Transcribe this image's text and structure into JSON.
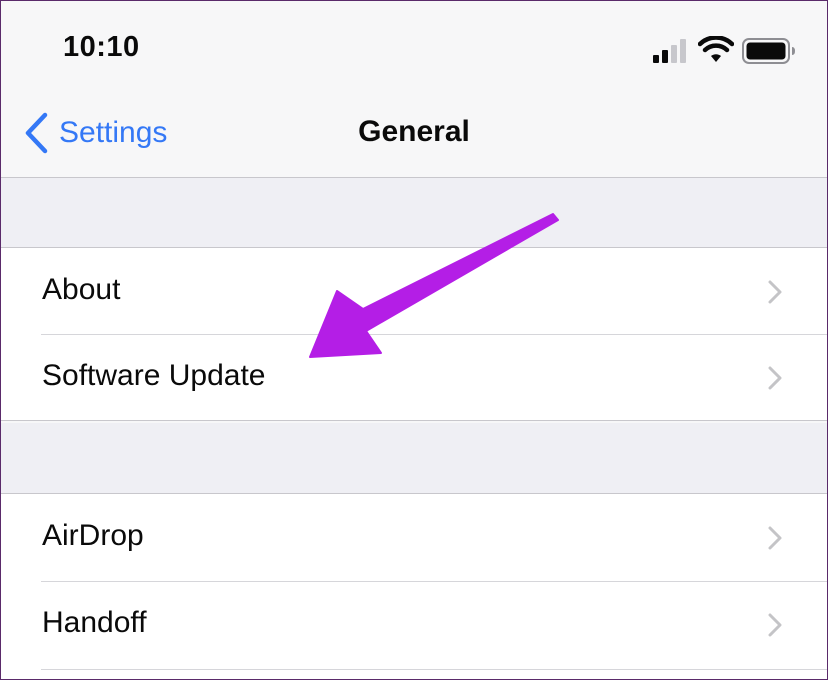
{
  "status_bar": {
    "time": "10:10",
    "icons": [
      "signal-icon",
      "wifi-icon",
      "battery-icon"
    ]
  },
  "nav": {
    "back_label": "Settings",
    "back_icon": "chevron-left-icon",
    "title": "General"
  },
  "groups": [
    {
      "rows": [
        {
          "label": "About",
          "icon": "chevron-right-icon"
        },
        {
          "label": "Software Update",
          "icon": "chevron-right-icon"
        }
      ]
    },
    {
      "rows": [
        {
          "label": "AirDrop",
          "icon": "chevron-right-icon"
        },
        {
          "label": "Handoff",
          "icon": "chevron-right-icon"
        }
      ]
    }
  ],
  "annotation": {
    "type": "arrow",
    "points_to": "Software Update",
    "color": "#b41ee6"
  },
  "colors": {
    "accent": "#3478f6",
    "separator": "#c8c7cc",
    "group_background": "#efeff4",
    "chevron": "#c4c4c7"
  }
}
